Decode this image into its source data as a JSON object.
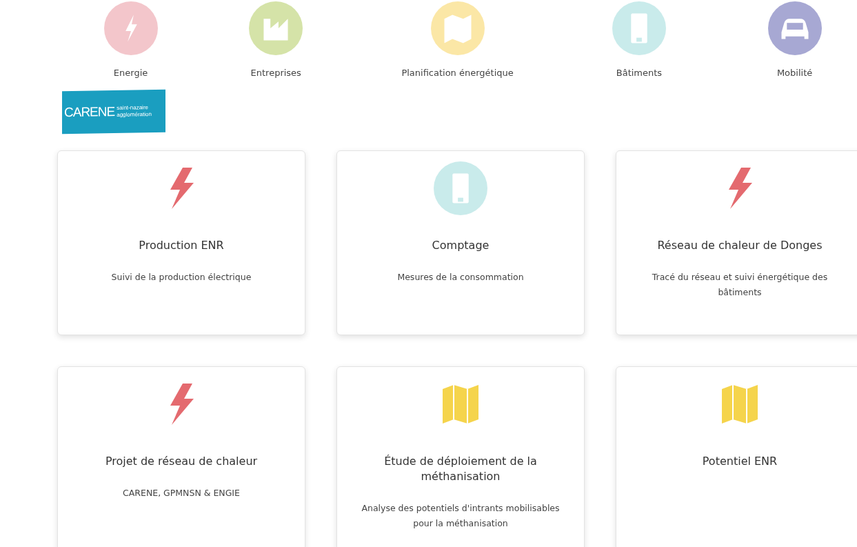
{
  "nav": [
    {
      "label": "Energie",
      "kind": "bolt"
    },
    {
      "label": "Entreprises",
      "kind": "factory"
    },
    {
      "label": "Planification énergétique",
      "kind": "map"
    },
    {
      "label": "Bâtiments",
      "kind": "building"
    },
    {
      "label": "Mobilité",
      "kind": "car"
    }
  ],
  "logo": {
    "name": "CARENE",
    "line_1": "saint-nazaire",
    "line_2": "agglomération"
  },
  "cards": [
    {
      "kind": "bolt",
      "title": "Production ENR",
      "description": "Suivi de la production électrique"
    },
    {
      "kind": "building",
      "title": "Comptage",
      "description": "Mesures de la consommation"
    },
    {
      "kind": "bolt",
      "title": "Réseau de chaleur de Donges",
      "description": "Tracé du réseau et suivi énergétique des bâtiments"
    },
    {
      "kind": "bolt",
      "title": "Projet de réseau de chaleur",
      "description": "CARENE, GPMNSN & ENGIE"
    },
    {
      "kind": "map",
      "title": "Étude de déploiement de la méthanisation",
      "description": "Analyse des potentiels d'intrants mobilisables pour la méthanisation"
    },
    {
      "kind": "map",
      "title": "Potentiel ENR"
    }
  ]
}
